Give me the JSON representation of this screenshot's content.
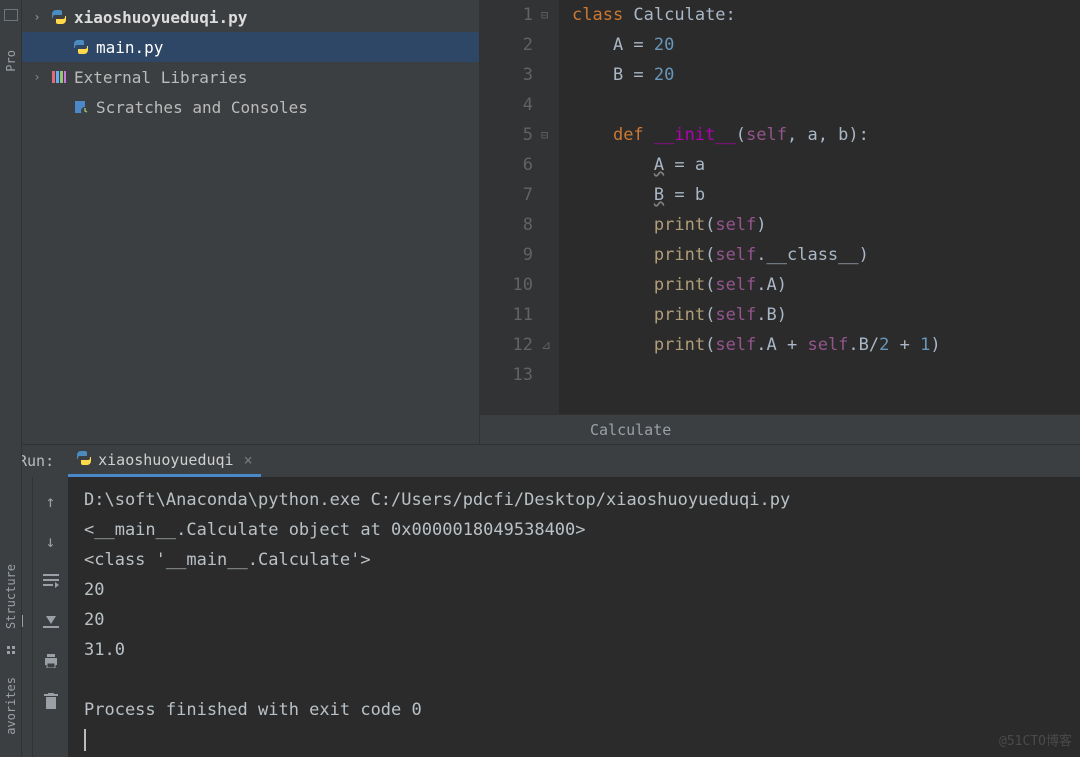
{
  "sidebar_labels": {
    "project": "Pro",
    "structure": "Structure",
    "favorites": "avorites"
  },
  "tree": {
    "items": [
      {
        "label": "xiaoshuoyueduqi.py",
        "bold": true,
        "arrow": true,
        "icon": "py"
      },
      {
        "label": "main.py",
        "bold": false,
        "arrow": false,
        "icon": "py",
        "selected": true,
        "indent": 1
      },
      {
        "label": "External Libraries",
        "bold": false,
        "arrow": true,
        "icon": "lib"
      },
      {
        "label": "Scratches and Consoles",
        "bold": false,
        "arrow": false,
        "icon": "scratch",
        "indent": 1
      }
    ]
  },
  "editor": {
    "line_numbers": [
      "1",
      "2",
      "3",
      "4",
      "5",
      "6",
      "7",
      "8",
      "9",
      "10",
      "11",
      "12",
      "13"
    ],
    "code_lines": [
      [
        {
          "t": "class ",
          "c": "kw"
        },
        {
          "t": "Calculate:",
          "c": "classname"
        }
      ],
      [
        {
          "t": "    A = ",
          "c": "str"
        },
        {
          "t": "20",
          "c": "num"
        }
      ],
      [
        {
          "t": "    B = ",
          "c": "str"
        },
        {
          "t": "20",
          "c": "num"
        }
      ],
      [
        {
          "t": "",
          "c": "str"
        }
      ],
      [
        {
          "t": "    ",
          "c": "str"
        },
        {
          "t": "def ",
          "c": "kw"
        },
        {
          "t": "__init__",
          "c": "funcname"
        },
        {
          "t": "(",
          "c": "paren"
        },
        {
          "t": "self",
          "c": "self"
        },
        {
          "t": ", a, b):",
          "c": "str"
        }
      ],
      [
        {
          "t": "        ",
          "c": "str"
        },
        {
          "t": "A",
          "c": "warn"
        },
        {
          "t": " = a",
          "c": "str"
        }
      ],
      [
        {
          "t": "        ",
          "c": "str"
        },
        {
          "t": "B",
          "c": "warn"
        },
        {
          "t": " = b",
          "c": "str"
        }
      ],
      [
        {
          "t": "        ",
          "c": "str"
        },
        {
          "t": "print",
          "c": "fn"
        },
        {
          "t": "(",
          "c": "paren"
        },
        {
          "t": "self",
          "c": "self"
        },
        {
          "t": ")",
          "c": "paren"
        }
      ],
      [
        {
          "t": "        ",
          "c": "str"
        },
        {
          "t": "print",
          "c": "fn"
        },
        {
          "t": "(",
          "c": "paren"
        },
        {
          "t": "self",
          "c": "self"
        },
        {
          "t": ".__class__)",
          "c": "str"
        }
      ],
      [
        {
          "t": "        ",
          "c": "str"
        },
        {
          "t": "print",
          "c": "fn"
        },
        {
          "t": "(",
          "c": "paren"
        },
        {
          "t": "self",
          "c": "self"
        },
        {
          "t": ".A)",
          "c": "str"
        }
      ],
      [
        {
          "t": "        ",
          "c": "str"
        },
        {
          "t": "print",
          "c": "fn"
        },
        {
          "t": "(",
          "c": "paren"
        },
        {
          "t": "self",
          "c": "self"
        },
        {
          "t": ".B)",
          "c": "str"
        }
      ],
      [
        {
          "t": "        ",
          "c": "str"
        },
        {
          "t": "print",
          "c": "fn"
        },
        {
          "t": "(",
          "c": "paren"
        },
        {
          "t": "self",
          "c": "self"
        },
        {
          "t": ".A + ",
          "c": "str"
        },
        {
          "t": "self",
          "c": "self"
        },
        {
          "t": ".B/",
          "c": "str"
        },
        {
          "t": "2",
          "c": "num"
        },
        {
          "t": " + ",
          "c": "str"
        },
        {
          "t": "1",
          "c": "num"
        },
        {
          "t": ")",
          "c": "paren"
        }
      ],
      [
        {
          "t": "",
          "c": "str"
        }
      ]
    ],
    "breadcrumb": "Calculate"
  },
  "run": {
    "header_label": "Run:",
    "tab_name": "xiaoshuoyueduqi",
    "console_lines": [
      "D:\\soft\\Anaconda\\python.exe C:/Users/pdcfi/Desktop/xiaoshuoyueduqi.py",
      "<__main__.Calculate object at 0x0000018049538400>",
      "<class '__main__.Calculate'>",
      "20",
      "20",
      "31.0",
      "",
      "Process finished with exit code 0"
    ]
  },
  "watermark": "@51CTO博客"
}
